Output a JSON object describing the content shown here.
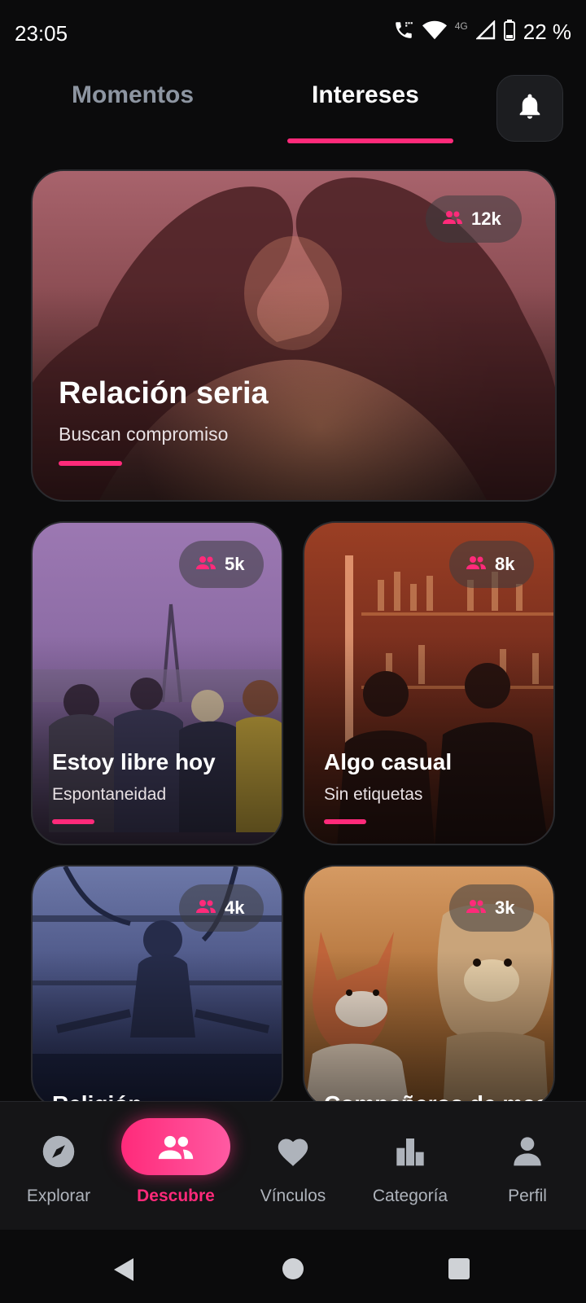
{
  "status_bar": {
    "time": "23:05",
    "network": "4G",
    "battery": "22 %"
  },
  "tabs": [
    {
      "label": "Momentos",
      "active": false
    },
    {
      "label": "Intereses",
      "active": true
    }
  ],
  "accent_color": "#ff2a7a",
  "cards": [
    {
      "title": "Relación seria",
      "subtitle": "Buscan compromiso",
      "count": "12k",
      "image": "heart-hands-sunset"
    },
    {
      "title": "Estoy libre hoy",
      "subtitle": "Espontaneidad",
      "count": "5k",
      "image": "friends-hugging"
    },
    {
      "title": "Algo casual",
      "subtitle": "Sin etiquetas",
      "count": "8k",
      "image": "bar-night"
    },
    {
      "title": "Religión",
      "subtitle": "",
      "count": "4k",
      "image": "meditation"
    },
    {
      "title": "Compañeros de mascotas",
      "subtitle": "",
      "count": "3k",
      "image": "dogs"
    }
  ],
  "bottom_nav": [
    {
      "label": "Explorar",
      "icon": "compass-icon",
      "active": false
    },
    {
      "label": "Descubre",
      "icon": "people-icon",
      "active": true
    },
    {
      "label": "Vínculos",
      "icon": "heart-icon",
      "active": false
    },
    {
      "label": "Categoría",
      "icon": "bar-chart-icon",
      "active": false
    },
    {
      "label": "Perfil",
      "icon": "person-icon",
      "active": false
    }
  ],
  "system_nav": [
    "back",
    "home",
    "recents"
  ]
}
